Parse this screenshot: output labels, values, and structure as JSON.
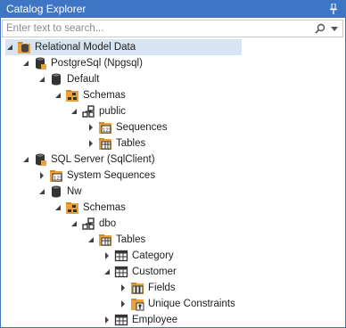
{
  "window": {
    "title": "Catalog Explorer"
  },
  "search": {
    "placeholder": "Enter text to search..."
  },
  "tree": [
    {
      "label": "Relational Model Data",
      "icon": "model-data-icon",
      "expanded": true,
      "selected": true
    },
    {
      "label": "PostgreSql (Npgsql)",
      "icon": "database-server-icon",
      "expanded": true
    },
    {
      "label": "Default",
      "icon": "database-icon",
      "expanded": true
    },
    {
      "label": "Schemas",
      "icon": "schemas-icon",
      "expanded": true
    },
    {
      "label": "public",
      "icon": "schema-icon",
      "expanded": true
    },
    {
      "label": "Sequences",
      "icon": "sequences-icon",
      "expanded": false
    },
    {
      "label": "Tables",
      "icon": "tables-icon",
      "expanded": false
    },
    {
      "label": "SQL Server (SqlClient)",
      "icon": "database-server-icon",
      "expanded": true
    },
    {
      "label": "System Sequences",
      "icon": "sequences-icon",
      "expanded": false
    },
    {
      "label": "Nw",
      "icon": "database-icon",
      "expanded": true
    },
    {
      "label": "Schemas",
      "icon": "schemas-icon",
      "expanded": true
    },
    {
      "label": "dbo",
      "icon": "schema-icon",
      "expanded": true
    },
    {
      "label": "Tables",
      "icon": "tables-icon",
      "expanded": true
    },
    {
      "label": "Category",
      "icon": "table-icon",
      "expanded": false
    },
    {
      "label": "Customer",
      "icon": "table-icon",
      "expanded": true
    },
    {
      "label": "Fields",
      "icon": "fields-icon",
      "expanded": false
    },
    {
      "label": "Unique Constraints",
      "icon": "unique-constraints-icon",
      "expanded": false
    },
    {
      "label": "Employee",
      "icon": "table-icon",
      "expanded": false
    }
  ]
}
